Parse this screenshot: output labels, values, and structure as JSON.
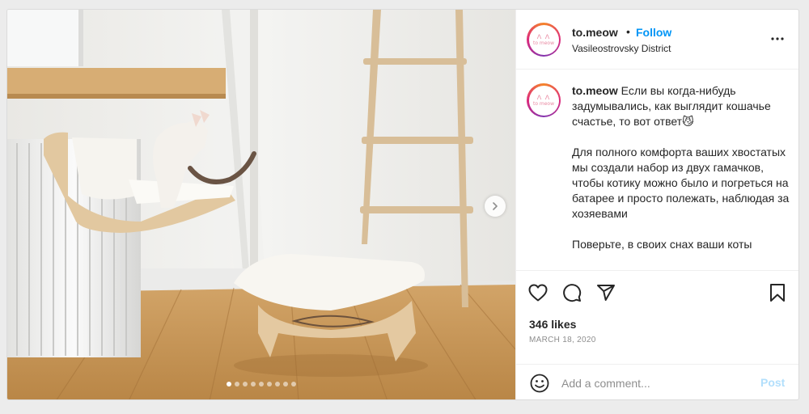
{
  "profile": {
    "username": "to.meow",
    "separator": "•",
    "follow_label": "Follow",
    "location": "Vasileostrovsky District",
    "avatar_ears": "ᐱ ᐱ",
    "avatar_logo": "to meow"
  },
  "media": {
    "carousel_count": 9,
    "active_index": 0,
    "next_icon": "chevron-right-icon"
  },
  "caption": {
    "username": "to.meow",
    "line_1": "Если вы когда-нибудь задумывались, как выглядит кошачье счастье, то вот ответ😼",
    "spacer_1": "⠀⠀",
    "line_2": "Для полного комфорта ваших хвостатых мы создали набор из двух гамачков, чтобы котику можно было и погреться на батарее и просто полежать, наблюдая за хозяевами",
    "spacer_2": "⠀⠀",
    "line_3": "Поверьте, в своих снах ваши коты"
  },
  "actions": {
    "icons": [
      "heart-icon",
      "comment-icon",
      "share-icon",
      "bookmark-icon"
    ],
    "likes": "346 likes",
    "date": "MARCH 18, 2020"
  },
  "comment": {
    "emoji_icon": "smile-icon",
    "placeholder": "Add a comment...",
    "post_label": "Post"
  },
  "colors": {
    "accent": "#0095f6",
    "post_disabled": "#b2dffc",
    "text": "#262626",
    "muted": "#8e8e8e"
  }
}
